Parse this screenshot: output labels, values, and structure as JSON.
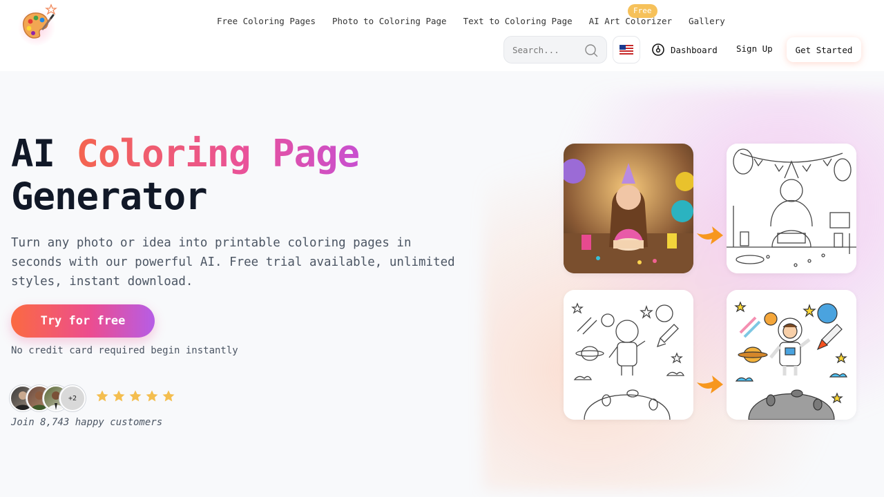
{
  "nav": {
    "items": [
      {
        "label": "Free Coloring Pages"
      },
      {
        "label": "Photo to Coloring Page"
      },
      {
        "label": "Text to Coloring Page"
      },
      {
        "label": "AI Art Colorizer"
      },
      {
        "label": "Gallery"
      }
    ],
    "free_badge": "Free"
  },
  "search": {
    "placeholder": "Search...",
    "icon": "search-icon"
  },
  "language": {
    "icon": "us-flag-icon"
  },
  "header_actions": {
    "dashboard_label": "Dashboard",
    "signup_label": "Sign Up",
    "get_started_label": "Get Started"
  },
  "hero": {
    "title_plain_1": "AI ",
    "title_highlight": "Coloring Page",
    "title_plain_2": "Generator",
    "subtitle": "Turn any photo or idea into printable coloring pages in seconds with our powerful AI. Free trial available, unlimited styles, instant download.",
    "cta_label": "Try for free",
    "note": "No credit card required begin instantly",
    "avatar_more": "+2",
    "rating_stars": 5,
    "social_proof": "Join 8,743 happy customers"
  },
  "colors": {
    "accent_orange": "#fb6a42",
    "accent_pink": "#ec4d8f",
    "accent_purple": "#b65de6",
    "star": "#f4be4f",
    "badge": "#f6c15a",
    "arrow": "#f7971e"
  },
  "gallery": {
    "tiles": [
      {
        "icon": "birthday-photo-image"
      },
      {
        "icon": "birthday-coloring-page-image"
      },
      {
        "icon": "astronaut-coloring-page-image"
      },
      {
        "icon": "astronaut-colored-image"
      }
    ],
    "arrow_icon": "arrow-right-icon"
  }
}
